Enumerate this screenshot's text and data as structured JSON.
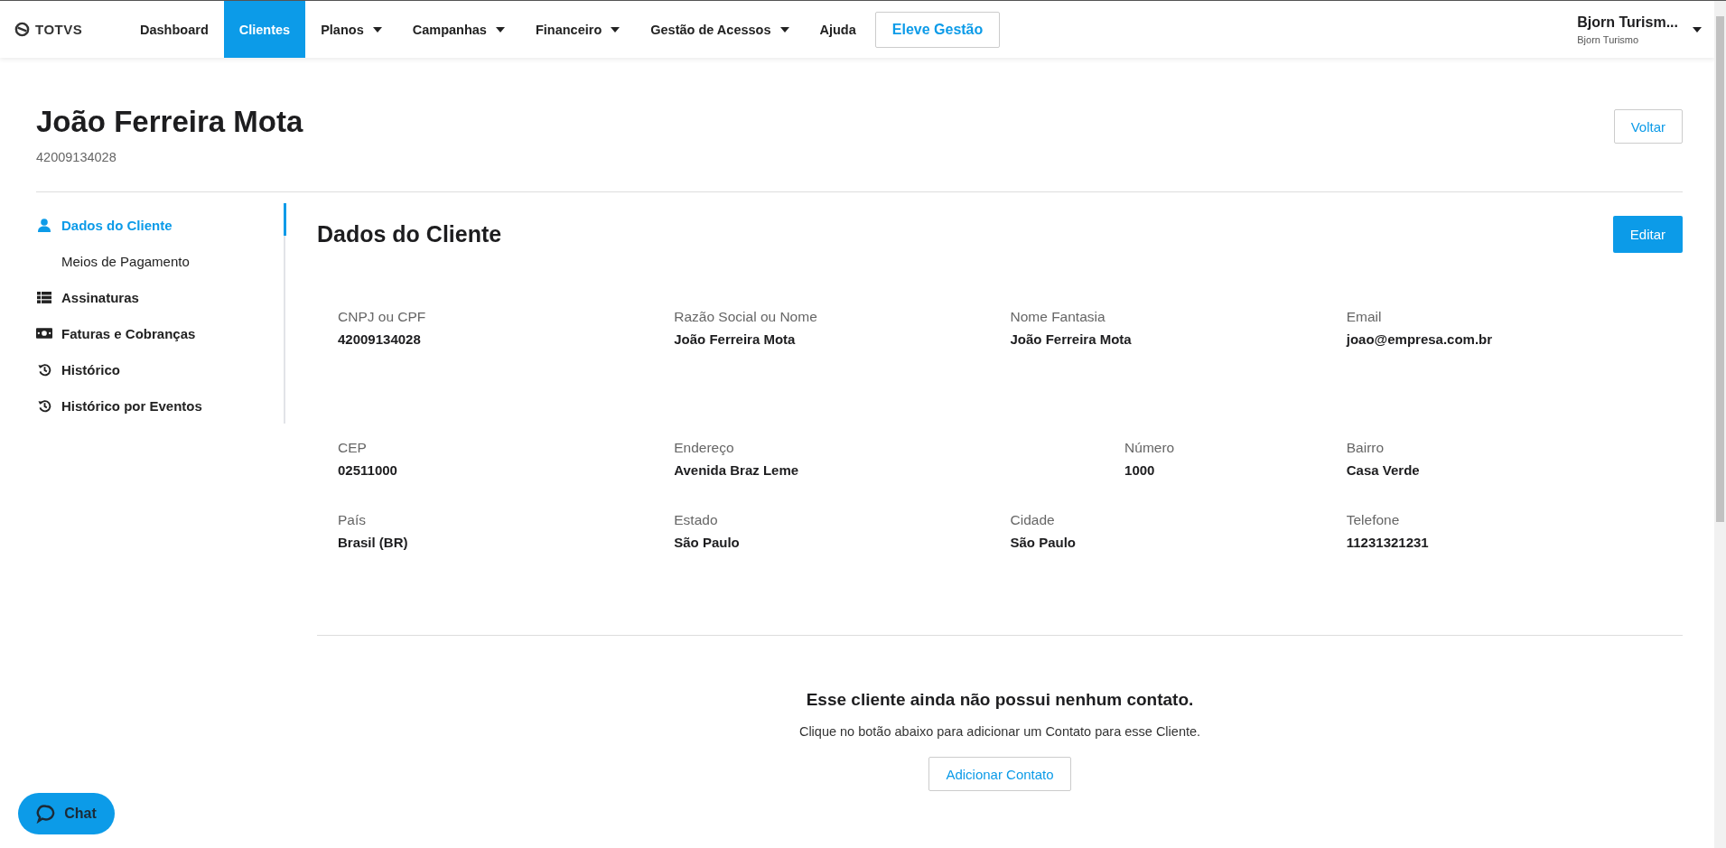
{
  "navbar": {
    "logo": "TOTVS",
    "items": [
      {
        "label": "Dashboard",
        "kind": "link",
        "selected": false
      },
      {
        "label": "Clientes",
        "kind": "link",
        "selected": true
      },
      {
        "label": "Planos",
        "kind": "menu",
        "selected": false
      },
      {
        "label": "Campanhas",
        "kind": "menu",
        "selected": false
      },
      {
        "label": "Financeiro",
        "kind": "menu",
        "selected": false
      },
      {
        "label": "Gestão de Acessos",
        "kind": "menu",
        "selected": false
      },
      {
        "label": "Ajuda",
        "kind": "link",
        "selected": false
      },
      {
        "label": "Eleve Gestão",
        "kind": "button",
        "selected": false
      }
    ],
    "user": {
      "name": "Bjorn Turism...",
      "company": "Bjorn Turismo"
    }
  },
  "header": {
    "title": "João Ferreira Mota",
    "subtitle": "42009134028",
    "back_button": "Voltar"
  },
  "sidebar": {
    "items": [
      {
        "label": "Dados do Cliente",
        "kind": "user",
        "selected": true
      },
      {
        "label": "Meios de Pagamento",
        "kind": "subitem",
        "selected": false
      },
      {
        "label": "Assinaturas",
        "kind": "list",
        "selected": false
      },
      {
        "label": "Faturas e Cobranças",
        "kind": "money",
        "selected": false
      },
      {
        "label": "Histórico",
        "kind": "history",
        "selected": false
      },
      {
        "label": "Histórico por Eventos",
        "kind": "history",
        "selected": false
      }
    ]
  },
  "section": {
    "title": "Dados do Cliente",
    "edit_button": "Editar",
    "rows": [
      {
        "kind": "standard",
        "fields": [
          {
            "label": "CNPJ ou CPF",
            "value": "42009134028"
          },
          {
            "label": "Razão Social ou Nome",
            "value": "João Ferreira Mota"
          },
          {
            "label": "Nome Fantasia",
            "value": "João Ferreira Mota"
          },
          {
            "label": "Email",
            "value": "joao@empresa.com.br"
          }
        ]
      },
      {
        "kind": "address",
        "fields": [
          {
            "label": "CEP",
            "value": "02511000"
          },
          {
            "label": "Endereço",
            "value": "Avenida Braz Leme"
          },
          {
            "label": "Número",
            "value": "1000"
          },
          {
            "label": "Bairro",
            "value": "Casa Verde"
          }
        ]
      },
      {
        "kind": "standard",
        "fields": [
          {
            "label": "País",
            "value": "Brasil (BR)"
          },
          {
            "label": "Estado",
            "value": "São Paulo"
          },
          {
            "label": "Cidade",
            "value": "São Paulo"
          },
          {
            "label": "Telefone",
            "value": "11231321231"
          }
        ]
      }
    ]
  },
  "contacts": {
    "empty_title": "Esse cliente ainda não possui nenhum contato.",
    "empty_text": "Clique no botão abaixo para adicionar um Contato para esse Cliente.",
    "add_button": "Adicionar Contato"
  },
  "chat": {
    "label": "Chat"
  }
}
